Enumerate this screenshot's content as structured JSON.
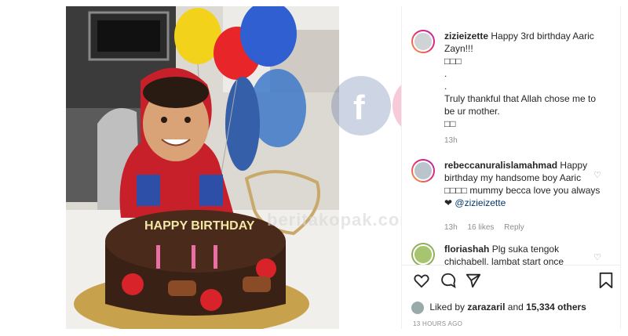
{
  "post": {
    "caption": {
      "username": "zizieizette",
      "text": "Happy 3rd birthday Aaric Zayn!!!",
      "emoji_line": "□□□",
      "dot1": ".",
      "dot2": ".",
      "body": "Truly thankful that Allah chose me to be ur mother.",
      "emoji_line2": "□□",
      "time": "13h"
    },
    "comments": [
      {
        "username": "rebeccanuralislamahmad",
        "text": "Happy birthday my handsome boy Aaric",
        "text2": "□□□□ mummy becca love you always ❤",
        "mention": "@zizieizette",
        "time": "13h",
        "likes": "16 likes",
        "reply": "Reply"
      },
      {
        "username": "floriashah",
        "text": "Plg suka tengok chichabell, lambat start once"
      }
    ],
    "likes": {
      "liked_by": "Liked by",
      "user": "zarazaril",
      "and": "and",
      "count": "15,334 others"
    },
    "posted": "13 HOURS AGO"
  },
  "watermark": {
    "text": "beritakopak.com"
  },
  "colors": {
    "accent": "#e6306b",
    "link": "#00376b",
    "muted": "#8e8e8e"
  },
  "icons": [
    "heart-icon",
    "comment-icon",
    "share-icon",
    "bookmark-icon"
  ]
}
